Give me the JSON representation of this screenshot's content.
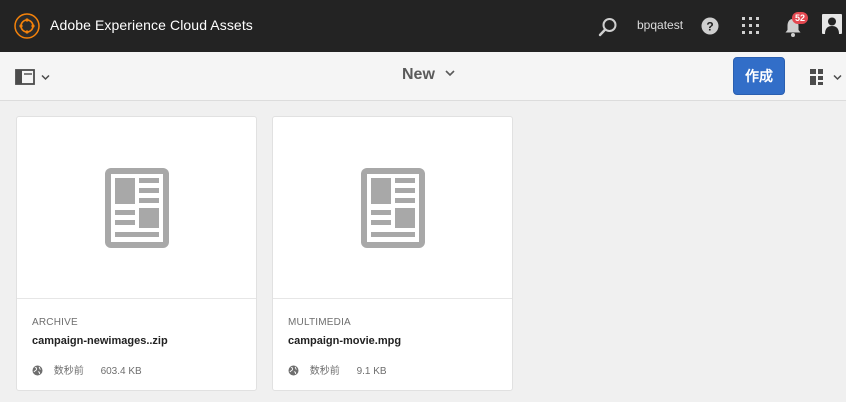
{
  "shell": {
    "app_title": "Adobe Experience Cloud Assets",
    "user": "bpqatest",
    "notification_count": "52",
    "icons": [
      "adobe-experience-cloud-logo",
      "search-icon",
      "help-icon",
      "apps-grid-icon",
      "bell-icon",
      "user-avatar-icon"
    ]
  },
  "actionbar": {
    "title": "New",
    "create_label": "作成",
    "create_color": "#326ec8",
    "icons": [
      "rail-toggle-icon",
      "chevron-down-icon",
      "card-view-icon"
    ]
  },
  "cards": [
    {
      "type": "ARCHIVE",
      "name": "campaign-newimages..zip",
      "modified": "数秒前",
      "size": "603.4 KB",
      "icon": "document-icon"
    },
    {
      "type": "MULTIMEDIA",
      "name": "campaign-movie.mpg",
      "modified": "数秒前",
      "size": "9.1 KB",
      "icon": "document-icon"
    }
  ]
}
